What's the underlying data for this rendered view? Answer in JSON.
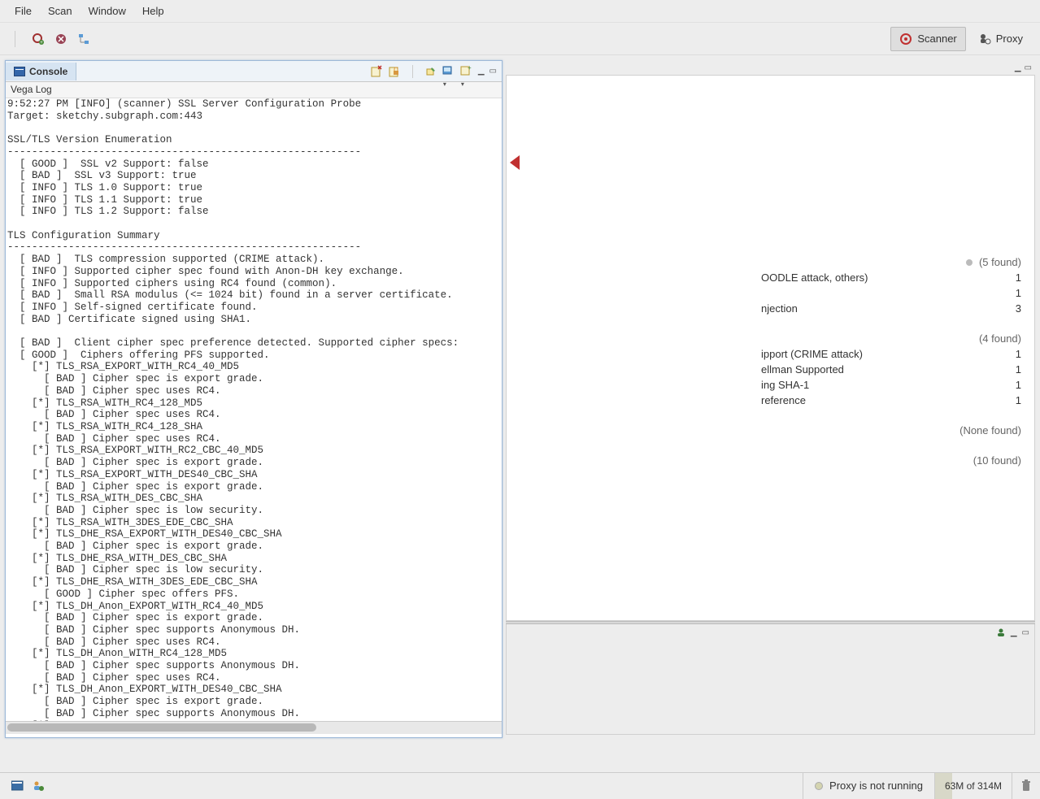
{
  "menu": {
    "file": "File",
    "scan": "Scan",
    "window": "Window",
    "help": "Help"
  },
  "perspectives": {
    "scanner": "Scanner",
    "proxy": "Proxy"
  },
  "console": {
    "tab": "Console",
    "vega_log_label": "Vega Log",
    "log": "9:52:27 PM [INFO] (scanner) SSL Server Configuration Probe\nTarget: sketchy.subgraph.com:443\n\nSSL/TLS Version Enumeration\n----------------------------------------------------------\n  [ GOOD ]  SSL v2 Support: false\n  [ BAD ]  SSL v3 Support: true\n  [ INFO ] TLS 1.0 Support: true\n  [ INFO ] TLS 1.1 Support: true\n  [ INFO ] TLS 1.2 Support: false\n\nTLS Configuration Summary\n----------------------------------------------------------\n  [ BAD ]  TLS compression supported (CRIME attack).\n  [ INFO ] Supported cipher spec found with Anon-DH key exchange.\n  [ INFO ] Supported ciphers using RC4 found (common).\n  [ BAD ]  Small RSA modulus (<= 1024 bit) found in a server certificate.\n  [ INFO ] Self-signed certificate found.\n  [ BAD ] Certificate signed using SHA1.\n\n  [ BAD ]  Client cipher spec preference detected. Supported cipher specs:\n  [ GOOD ]  Ciphers offering PFS supported.\n    [*] TLS_RSA_EXPORT_WITH_RC4_40_MD5\n      [ BAD ] Cipher spec is export grade.\n      [ BAD ] Cipher spec uses RC4.\n    [*] TLS_RSA_WITH_RC4_128_MD5\n      [ BAD ] Cipher spec uses RC4.\n    [*] TLS_RSA_WITH_RC4_128_SHA\n      [ BAD ] Cipher spec uses RC4.\n    [*] TLS_RSA_EXPORT_WITH_RC2_CBC_40_MD5\n      [ BAD ] Cipher spec is export grade.\n    [*] TLS_RSA_EXPORT_WITH_DES40_CBC_SHA\n      [ BAD ] Cipher spec is export grade.\n    [*] TLS_RSA_WITH_DES_CBC_SHA\n      [ BAD ] Cipher spec is low security.\n    [*] TLS_RSA_WITH_3DES_EDE_CBC_SHA\n    [*] TLS_DHE_RSA_EXPORT_WITH_DES40_CBC_SHA\n      [ BAD ] Cipher spec is export grade.\n    [*] TLS_DHE_RSA_WITH_DES_CBC_SHA\n      [ BAD ] Cipher spec is low security.\n    [*] TLS_DHE_RSA_WITH_3DES_EDE_CBC_SHA\n      [ GOOD ] Cipher spec offers PFS.\n    [*] TLS_DH_Anon_EXPORT_WITH_RC4_40_MD5\n      [ BAD ] Cipher spec is export grade.\n      [ BAD ] Cipher spec supports Anonymous DH.\n      [ BAD ] Cipher spec uses RC4.\n    [*] TLS_DH_Anon_WITH_RC4_128_MD5\n      [ BAD ] Cipher spec supports Anonymous DH.\n      [ BAD ] Cipher spec uses RC4.\n    [*] TLS_DH_Anon_EXPORT_WITH_DES40_CBC_SHA\n      [ BAD ] Cipher spec is export grade.\n      [ BAD ] Cipher spec supports Anonymous DH.\n    [*] TLS_DH_Anon_WITH_DES_CBC_SHA"
  },
  "findings": {
    "s1": {
      "count": "(5 found)",
      "r1": {
        "label": "OODLE attack, others)",
        "n": "1"
      },
      "r2": {
        "label": "",
        "n": "1"
      },
      "r3": {
        "label": "njection",
        "n": "3"
      }
    },
    "s2": {
      "count": "(4 found)",
      "r1": {
        "label": "ipport (CRIME attack)",
        "n": "1"
      },
      "r2": {
        "label": "ellman Supported",
        "n": "1"
      },
      "r3": {
        "label": "ing SHA-1",
        "n": "1"
      },
      "r4": {
        "label": "reference",
        "n": "1"
      }
    },
    "s3": {
      "count": "(None found)"
    },
    "s4": {
      "count": "(10 found)"
    }
  },
  "status": {
    "proxy": "Proxy is not running",
    "memory": "63M of 314M"
  }
}
